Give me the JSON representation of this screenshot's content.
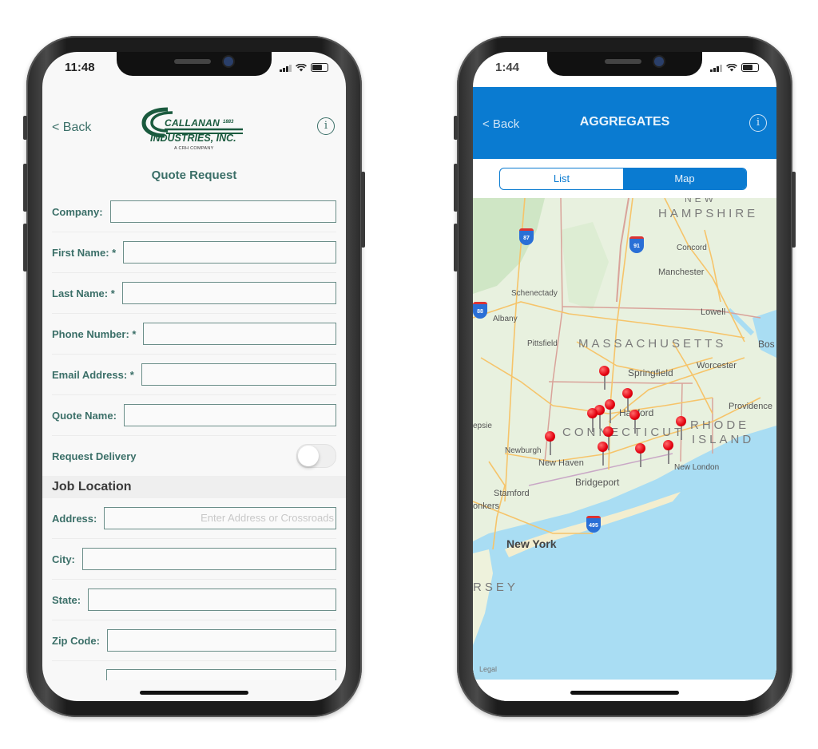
{
  "left_phone": {
    "status_time": "11:48",
    "nav": {
      "back_label": "< Back",
      "info_icon": "info-icon"
    },
    "logo": {
      "line1": "CALLANAN",
      "year": "1883",
      "line2": "INDUSTRIES, INC.",
      "line3": "A CRH COMPANY"
    },
    "page_title": "Quote Request",
    "fields": [
      {
        "label": "Company:",
        "value": "",
        "placeholder": ""
      },
      {
        "label": "First Name: *",
        "value": "",
        "placeholder": ""
      },
      {
        "label": "Last Name: *",
        "value": "",
        "placeholder": ""
      },
      {
        "label": "Phone Number: *",
        "value": "",
        "placeholder": ""
      },
      {
        "label": "Email Address: *",
        "value": "",
        "placeholder": ""
      },
      {
        "label": "Quote Name:",
        "value": "",
        "placeholder": ""
      }
    ],
    "toggle": {
      "label": "Request Delivery",
      "on": false
    },
    "section_title": "Job Location",
    "location_fields": [
      {
        "label": "Address:",
        "value": "",
        "placeholder": "Enter Address or Crossroads"
      },
      {
        "label": "City:",
        "value": "",
        "placeholder": ""
      },
      {
        "label": "State:",
        "value": "",
        "placeholder": ""
      },
      {
        "label": "Zip Code:",
        "value": "",
        "placeholder": ""
      }
    ],
    "colors": {
      "accent": "#3b6f68",
      "logo_green": "#1a5a3e"
    }
  },
  "right_phone": {
    "status_time": "1:44",
    "appbar": {
      "back_label": "< Back",
      "title": "AGGREGATES",
      "info_icon": "info-icon"
    },
    "segments": [
      {
        "label": "List",
        "selected": false
      },
      {
        "label": "Map",
        "selected": true
      }
    ],
    "map": {
      "states": [
        "NEW",
        "HAMPSHIRE",
        "MASSACHUSETTS",
        "CONNECTICUT",
        "RHODE",
        "ISLAND",
        "RSEY"
      ],
      "cities": [
        "Concord",
        "Manchester",
        "Schenectady",
        "Albany",
        "Lowell",
        "Pittsfield",
        "Worcester",
        "Bos",
        "Springfield",
        "Providence",
        "Hartford",
        "epsie",
        "Newburgh",
        "New Haven",
        "New London",
        "Bridgeport",
        "Stamford",
        "onkers",
        "New York"
      ],
      "highway_shields": [
        "87",
        "91",
        "88",
        "495"
      ],
      "pin_count": 12,
      "legal": "Legal"
    },
    "colors": {
      "primary": "#0a7bd1",
      "pin": "#e3000f",
      "water": "#a9ddf3",
      "land": "#e8f1df"
    }
  }
}
